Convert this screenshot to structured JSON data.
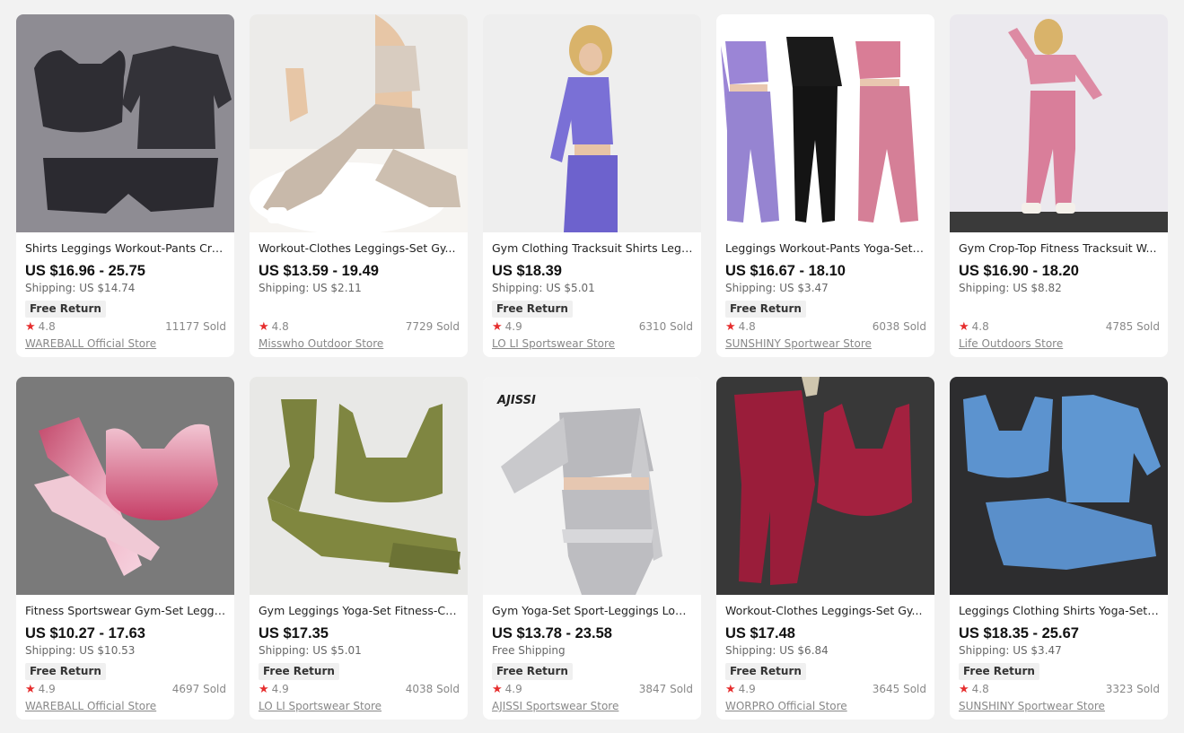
{
  "products": [
    {
      "title": "Shirts Leggings Workout-Pants Cro...",
      "price": "US $16.96 - 25.75",
      "shipping": "Shipping: US $14.74",
      "badge": "Free Return",
      "rating": "4.8",
      "sold": "11177 Sold",
      "store": "WAREBALL Official Store",
      "image_icon": "charcoal-set-photo"
    },
    {
      "title": "Workout-Clothes Leggings-Set Gy...",
      "price": "US $13.59 - 19.49",
      "shipping": "Shipping: US $2.11",
      "badge": "",
      "rating": "4.8",
      "sold": "7729 Sold",
      "store": "Misswho Outdoor Store",
      "image_icon": "beige-set-model-photo"
    },
    {
      "title": "Gym Clothing Tracksuit Shirts Legg...",
      "price": "US $18.39",
      "shipping": "Shipping: US $5.01",
      "badge": "Free Return",
      "rating": "4.9",
      "sold": "6310 Sold",
      "store": "LO LI Sportswear Store",
      "image_icon": "purple-set-model-photo"
    },
    {
      "title": "Leggings Workout-Pants Yoga-Set ...",
      "price": "US $16.67 - 18.10",
      "shipping": "Shipping: US $3.47",
      "badge": "Free Return",
      "rating": "4.8",
      "sold": "6038 Sold",
      "store": "SUNSHINY Sportwear Store",
      "image_icon": "three-models-photo"
    },
    {
      "title": "Gym Crop-Top Fitness Tracksuit W...",
      "price": "US $16.90 - 18.20",
      "shipping": "Shipping: US $8.82",
      "badge": "",
      "rating": "4.8",
      "sold": "4785 Sold",
      "store": "Life Outdoors Store",
      "image_icon": "pink-set-model-photo"
    },
    {
      "title": "Fitness Sportswear Gym-Set Leggi...",
      "price": "US $10.27 - 17.63",
      "shipping": "Shipping: US $10.53",
      "badge": "Free Return",
      "rating": "4.9",
      "sold": "4697 Sold",
      "store": "WAREBALL Official Store",
      "image_icon": "pink-gradient-set-photo"
    },
    {
      "title": "Gym Leggings Yoga-Set Fitness-Clo...",
      "price": "US $17.35",
      "shipping": "Shipping: US $5.01",
      "badge": "Free Return",
      "rating": "4.9",
      "sold": "4038 Sold",
      "store": "LO LI Sportswear Store",
      "image_icon": "olive-set-photo"
    },
    {
      "title": "Gym Yoga-Set Sport-Leggings Long...",
      "price": "US $13.78 - 23.58",
      "shipping": "Free Shipping",
      "badge": "Free Return",
      "rating": "4.9",
      "sold": "3847 Sold",
      "store": "AJISSI Sportswear Store",
      "image_icon": "grey-set-model-photo",
      "image_text": "AJISSI"
    },
    {
      "title": "Workout-Clothes Leggings-Set Gy...",
      "price": "US $17.48",
      "shipping": "Shipping: US $6.84",
      "badge": "Free Return",
      "rating": "4.9",
      "sold": "3645 Sold",
      "store": "WORPRO Official Store",
      "image_icon": "burgundy-set-photo"
    },
    {
      "title": "Leggings Clothing Shirts Yoga-Set ...",
      "price": "US $18.35 - 25.67",
      "shipping": "Shipping: US $3.47",
      "badge": "Free Return",
      "rating": "4.8",
      "sold": "3323 Sold",
      "store": "SUNSHINY Sportwear Store",
      "image_icon": "blue-set-photo"
    }
  ],
  "colors": {
    "star": "#e62e2e",
    "background": "#f2f2f2"
  }
}
